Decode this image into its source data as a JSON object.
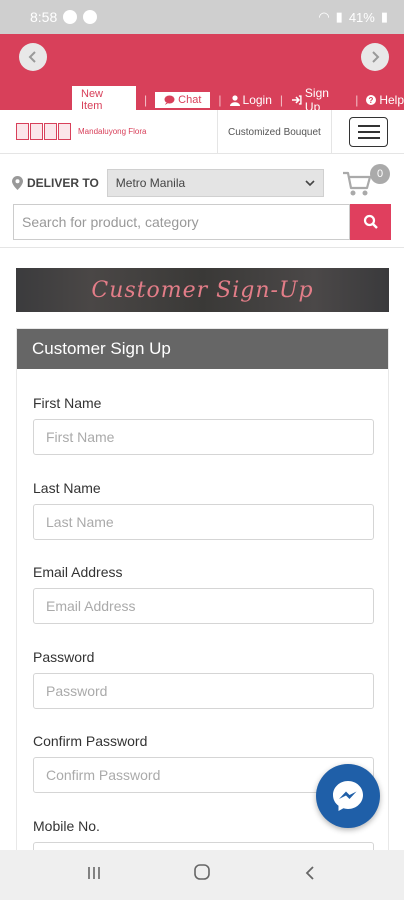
{
  "status_bar": {
    "time": "8:58",
    "battery": "41%"
  },
  "top_links": {
    "new_item": "New Item",
    "chat": "Chat",
    "login": "Login",
    "signup": "Sign Up",
    "help": "Help"
  },
  "logo": {
    "text": "Mandaluyong Flora"
  },
  "header": {
    "customized_bouquet": "Customized Bouquet"
  },
  "deliver": {
    "label": "DELIVER TO",
    "selected": "Metro Manila"
  },
  "cart": {
    "count": "0"
  },
  "search": {
    "placeholder": "Search for product, category"
  },
  "banner": {
    "text": "Customer Sign-Up"
  },
  "form": {
    "title": "Customer Sign Up",
    "fields": [
      {
        "label": "First Name",
        "placeholder": "First Name"
      },
      {
        "label": "Last Name",
        "placeholder": "Last Name"
      },
      {
        "label": "Email Address",
        "placeholder": "Email Address"
      },
      {
        "label": "Password",
        "placeholder": "Password"
      },
      {
        "label": "Confirm Password",
        "placeholder": "Confirm Password"
      },
      {
        "label": "Mobile No.",
        "placeholder": ""
      }
    ]
  },
  "colors": {
    "brand": "#d8405a",
    "search_button": "#e03f5e",
    "messenger": "#1f5fa8",
    "form_header": "#666666"
  }
}
